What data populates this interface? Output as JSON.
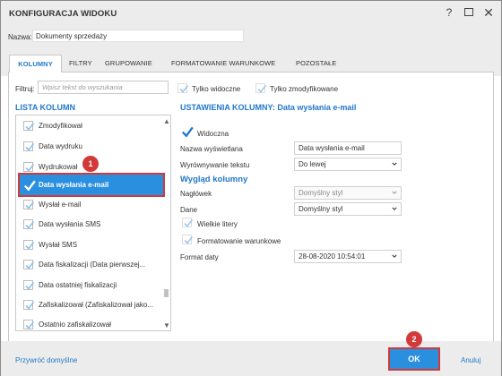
{
  "window": {
    "title": "KONFIGURACJA WIDOKU",
    "help_glyph": "?",
    "close_glyph": "✕"
  },
  "name_row": {
    "label": "Nazwa:",
    "value": "Dokumenty sprzedaży"
  },
  "tabs": [
    {
      "label": "KOLUMNY",
      "active": true
    },
    {
      "label": "FILTRY",
      "active": false
    },
    {
      "label": "GRUPOWANIE",
      "active": false
    },
    {
      "label": "FORMATOWANIE WARUNKOWE",
      "active": false
    },
    {
      "label": "POZOSTAŁE",
      "active": false
    }
  ],
  "filter": {
    "label": "Filtruj:",
    "placeholder": "Wpisz tekst do wyszukania",
    "only_visible_label": "Tylko widoczne",
    "only_modified_label": "Tylko zmodyfikowane"
  },
  "column_list": {
    "title": "LISTA KOLUMN",
    "items": [
      {
        "label": "Zmodyfikował",
        "checked": true
      },
      {
        "label": "Data wydruku",
        "checked": true
      },
      {
        "label": "Wydrukował",
        "checked": true
      },
      {
        "label": "Data wysłania e-mail",
        "checked": true,
        "selected": true
      },
      {
        "label": "Wysłał e-mail",
        "checked": true
      },
      {
        "label": "Data wysłania SMS",
        "checked": true
      },
      {
        "label": "Wysłał SMS",
        "checked": true
      },
      {
        "label": "Data fiskalizacji (Data pierwszej...",
        "checked": true
      },
      {
        "label": "Data ostatniej fiskalizacji",
        "checked": true
      },
      {
        "label": "Zafiskalizował (Zafiskalizował jako...",
        "checked": true
      },
      {
        "label": "Ostatnio zafiskalizował",
        "checked": true
      }
    ],
    "scroll_up_glyph": "▲",
    "scroll_down_glyph": "▼"
  },
  "settings": {
    "title": "USTAWIENIA KOLUMNY: Data wysłania e-mail",
    "visible_label": "Widoczna",
    "display_name_label": "Nazwa wyświetlana",
    "display_name_value": "Data wysłania e-mail",
    "alignment_label": "Wyrównywanie tekstu",
    "alignment_value": "Do lewej",
    "appearance_title": "Wygląd kolumny",
    "header_label": "Nagłówek",
    "header_value": "Domyślny styl",
    "data_label": "Dane",
    "data_value": "Domyślny styl",
    "uppercase_label": "Wielkie litery",
    "conditional_label": "Formatowanie warunkowe",
    "date_format_label": "Format daty",
    "date_format_value": "28-08-2020 10:54:01"
  },
  "badges": {
    "first": "1",
    "second": "2"
  },
  "footer": {
    "reset_label": "Przywróć domyślne",
    "ok_label": "OK",
    "cancel_label": "Anuluj"
  },
  "colors": {
    "accent": "#2278c9",
    "selection": "#2b8fe0",
    "highlight": "#d23a3a"
  }
}
